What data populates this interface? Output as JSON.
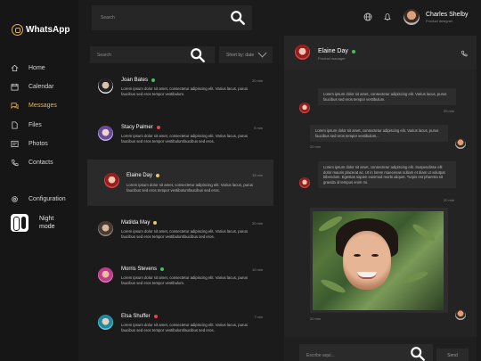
{
  "app": {
    "name": "WhatsApp",
    "accent": "#e7b553"
  },
  "nav": {
    "items": [
      {
        "label": "Home",
        "icon": "home-icon"
      },
      {
        "label": "Calendar",
        "icon": "calendar-icon"
      },
      {
        "label": "Messages",
        "icon": "messages-icon",
        "active": true
      },
      {
        "label": "Files",
        "icon": "files-icon"
      },
      {
        "label": "Photos",
        "icon": "photos-icon"
      },
      {
        "label": "Contacts",
        "icon": "contacts-icon"
      },
      {
        "label": "Configuration",
        "icon": "gear-icon"
      }
    ],
    "night_mode_label": "Night mode"
  },
  "header": {
    "search_placeholder": "Search",
    "user_name": "Charles Shelby",
    "user_role": "Product designer"
  },
  "list": {
    "search_placeholder": "Search",
    "sort_label": "Short by: date",
    "contacts": [
      {
        "name": "Joan Bates",
        "status": "online",
        "time": "20 min",
        "preview": "Lorem ipsum dolor sit amet, consectetur adipiscing elit. Varius lacus, purus faucibus sed eros tempor vestibulum."
      },
      {
        "name": "Stacy Palmer",
        "status": "busy",
        "time": "5 min",
        "preview": "Lorem ipsum dolor sit amet, consectetur adipiscing elit. Varius lacus, purus faucibus sed eros tempor vestibulumfaucibus sed eros."
      },
      {
        "name": "Elaine Day",
        "status": "away",
        "time": "15 min",
        "preview": "Lorem ipsum dolor sit amet, consectetur adipiscing elit. Varius lacus, purus faucibus sed eros tempor vestibulumfaucibus sed eros."
      },
      {
        "name": "Matilda May",
        "status": "away",
        "time": "20 min",
        "preview": "Lorem ipsum dolor sit amet, consectetur adipiscing elit. Varius lacus, purus faucibus sed eros tempor vestibulumfaucibus sed eros."
      },
      {
        "name": "Morris Stevens",
        "status": "online",
        "time": "10 min",
        "preview": "Lorem ipsum dolor sit amet, consectetur adipiscing elit. Varius lacus, purus faucibus sed eros tempor vestibulum."
      },
      {
        "name": "Elsa Shuffer",
        "status": "busy",
        "time": "7 min",
        "preview": "Lorem ipsum dolor sit amet, consectetur adipiscing elit. Varius lacus, purus faucibus sed eros tempor vestibulumfaucibus sed eros."
      }
    ]
  },
  "status_colors": {
    "online": "#3ec45a",
    "busy": "#e0484a",
    "away": "#e7c86a"
  },
  "chat": {
    "name": "Elaine Day",
    "role": "Product manager",
    "messages": [
      {
        "text": "Lorem ipsum dolor sit amet, consectetur adipiscing elit. Varius lacus, purus faucibus sed eros tempor vestibulum.",
        "time": "20 min"
      },
      {
        "text": "Lorem ipsum dolor sit amet, consectetur adipiscing elit. Varius lacus, purus faucibus sed eros tempor vestibulum...",
        "time": "20 min"
      },
      {
        "text": "Lorem ipsum dolor sit amet, consectetur adipiscing elit. Suspendisse elit dolor mauris placerat ac. Ut in lorem maecenas nullam et diam ut volutpat bibendum. Egestas sapien euismod morbi aliquet. Turpis est pharetra sit gravida id tempus enim mi.",
        "time": "20 min"
      }
    ],
    "photo_time": "20 min",
    "compose_placeholder": "Escribe aqui...",
    "send_label": "Send"
  }
}
